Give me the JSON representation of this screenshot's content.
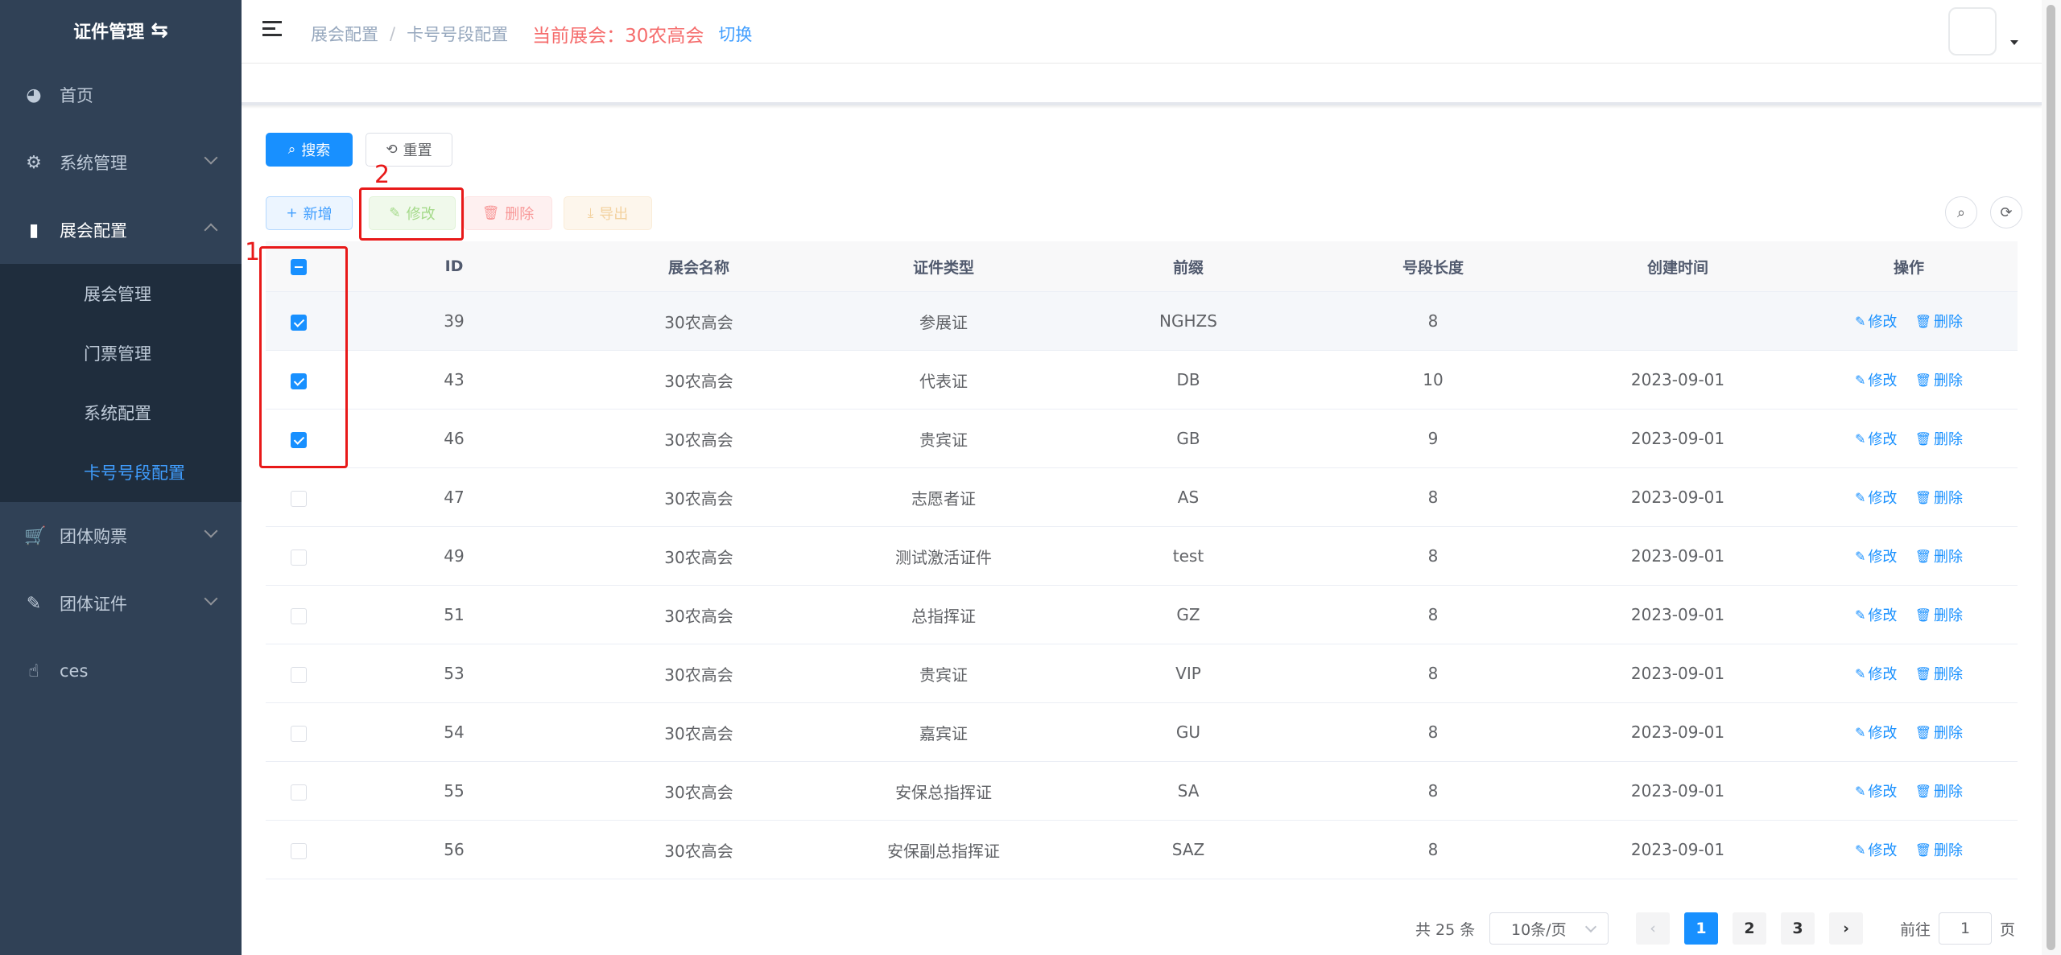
{
  "sidebar": {
    "title": "证件管理",
    "logo_icon": "swap-icon",
    "menu": [
      {
        "label": "首页",
        "icon": "dashboard-icon"
      },
      {
        "label": "系统管理",
        "icon": "gear-icon"
      },
      {
        "label": "展会配置",
        "icon": "clapper-icon"
      },
      {
        "label": "团体购票",
        "icon": "cart-icon"
      },
      {
        "label": "团体证件",
        "icon": "edit-icon"
      },
      {
        "label": "ces",
        "icon": "hand-icon"
      }
    ],
    "submenu": [
      {
        "label": "展会管理"
      },
      {
        "label": "门票管理"
      },
      {
        "label": "系统配置"
      },
      {
        "label": "卡号号段配置"
      }
    ],
    "active_color": "#409eff"
  },
  "header": {
    "breadcrumb": [
      "展会配置",
      "卡号号段配置"
    ],
    "current_expo_label": "当前展会：",
    "current_expo_value": "30农高会",
    "switch_label": "切换"
  },
  "toolbar": {
    "search_label": "搜索",
    "reset_label": "重置",
    "add_label": "新增",
    "edit_label": "修改",
    "delete_label": "删除",
    "export_label": "导出"
  },
  "table": {
    "columns": [
      "ID",
      "展会名称",
      "证件类型",
      "前缀",
      "号段长度",
      "创建时间",
      "操作"
    ],
    "op_edit": "修改",
    "op_delete": "删除",
    "rows": [
      {
        "id": "39",
        "expo": "30农高会",
        "type": "参展证",
        "prefix": "NGHZS",
        "length": "8",
        "created": "",
        "checked": true
      },
      {
        "id": "43",
        "expo": "30农高会",
        "type": "代表证",
        "prefix": "DB",
        "length": "10",
        "created": "2023-09-01",
        "checked": true
      },
      {
        "id": "46",
        "expo": "30农高会",
        "type": "贵宾证",
        "prefix": "GB",
        "length": "9",
        "created": "2023-09-01",
        "checked": true
      },
      {
        "id": "47",
        "expo": "30农高会",
        "type": "志愿者证",
        "prefix": "AS",
        "length": "8",
        "created": "2023-09-01",
        "checked": false
      },
      {
        "id": "49",
        "expo": "30农高会",
        "type": "测试激活证件",
        "prefix": "test",
        "length": "8",
        "created": "2023-09-01",
        "checked": false
      },
      {
        "id": "51",
        "expo": "30农高会",
        "type": "总指挥证",
        "prefix": "GZ",
        "length": "8",
        "created": "2023-09-01",
        "checked": false
      },
      {
        "id": "53",
        "expo": "30农高会",
        "type": "贵宾证",
        "prefix": "VIP",
        "length": "8",
        "created": "2023-09-01",
        "checked": false
      },
      {
        "id": "54",
        "expo": "30农高会",
        "type": "嘉宾证",
        "prefix": "GU",
        "length": "8",
        "created": "2023-09-01",
        "checked": false
      },
      {
        "id": "55",
        "expo": "30农高会",
        "type": "安保总指挥证",
        "prefix": "SA",
        "length": "8",
        "created": "2023-09-01",
        "checked": false
      },
      {
        "id": "56",
        "expo": "30农高会",
        "type": "安保副总指挥证",
        "prefix": "SAZ",
        "length": "8",
        "created": "2023-09-01",
        "checked": false
      }
    ]
  },
  "annotations": {
    "box1": "1",
    "box2": "2"
  },
  "pagination": {
    "total": "共 25 条",
    "page_size": "10条/页",
    "pages": [
      "1",
      "2",
      "3"
    ],
    "current_page": "1",
    "goto_label": "前往",
    "goto_value": "1",
    "page_suffix": "页"
  }
}
